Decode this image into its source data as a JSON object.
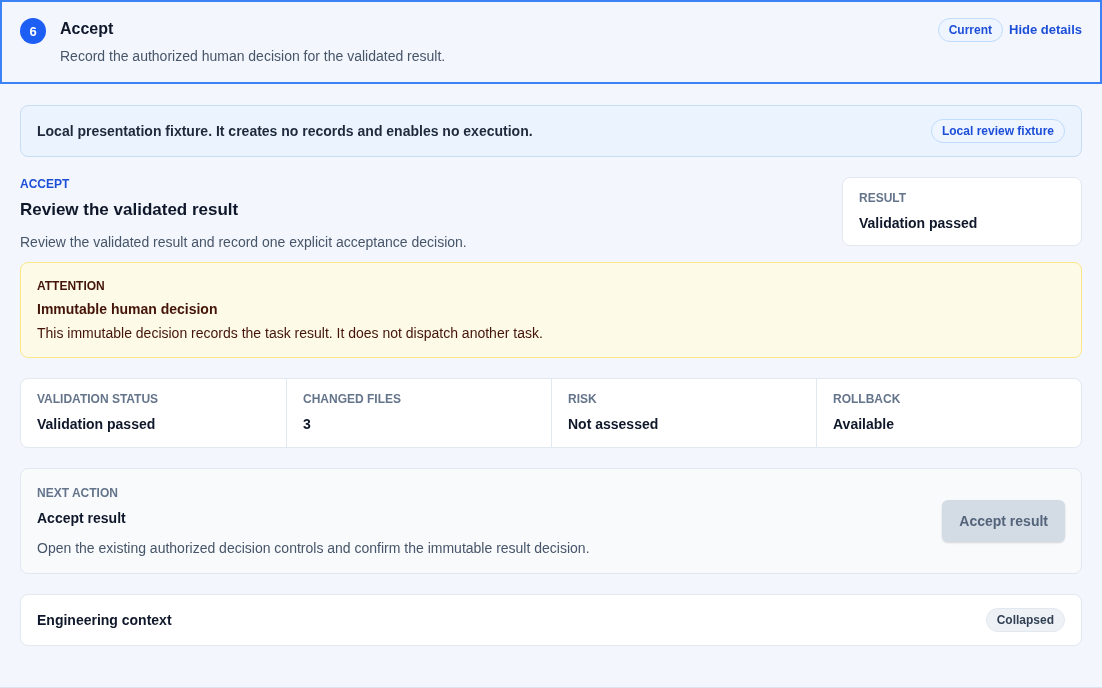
{
  "step": {
    "number": "6",
    "title": "Accept",
    "subtitle": "Record the authorized human decision for the validated result.",
    "current": true,
    "status_badge": "Current",
    "toggle_link": "Hide details"
  },
  "notice": {
    "text": "Local presentation fixture. It creates no records and enables no execution.",
    "badge": "Local review fixture"
  },
  "intro": {
    "eyebrow": "ACCEPT",
    "title": "Review the validated result",
    "description": "Review the validated result and record one explicit acceptance decision."
  },
  "result_card": {
    "label": "RESULT",
    "value": "Validation passed"
  },
  "attention": {
    "label": "ATTENTION",
    "title": "Immutable human decision",
    "text": "This immutable decision records the task result. It does not dispatch another task."
  },
  "stats": [
    {
      "label": "VALIDATION STATUS",
      "value": "Validation passed"
    },
    {
      "label": "CHANGED FILES",
      "value": "3"
    },
    {
      "label": "RISK",
      "value": "Not assessed"
    },
    {
      "label": "ROLLBACK",
      "value": "Available"
    }
  ],
  "next_action": {
    "label": "NEXT ACTION",
    "title": "Accept result",
    "text": "Open the existing authorized decision controls and confirm the immutable result decision.",
    "button": {
      "label": "Accept result",
      "disabled": true
    }
  },
  "engineering_context": {
    "title": "Engineering context",
    "expanded": false,
    "badge": "Collapsed"
  }
}
